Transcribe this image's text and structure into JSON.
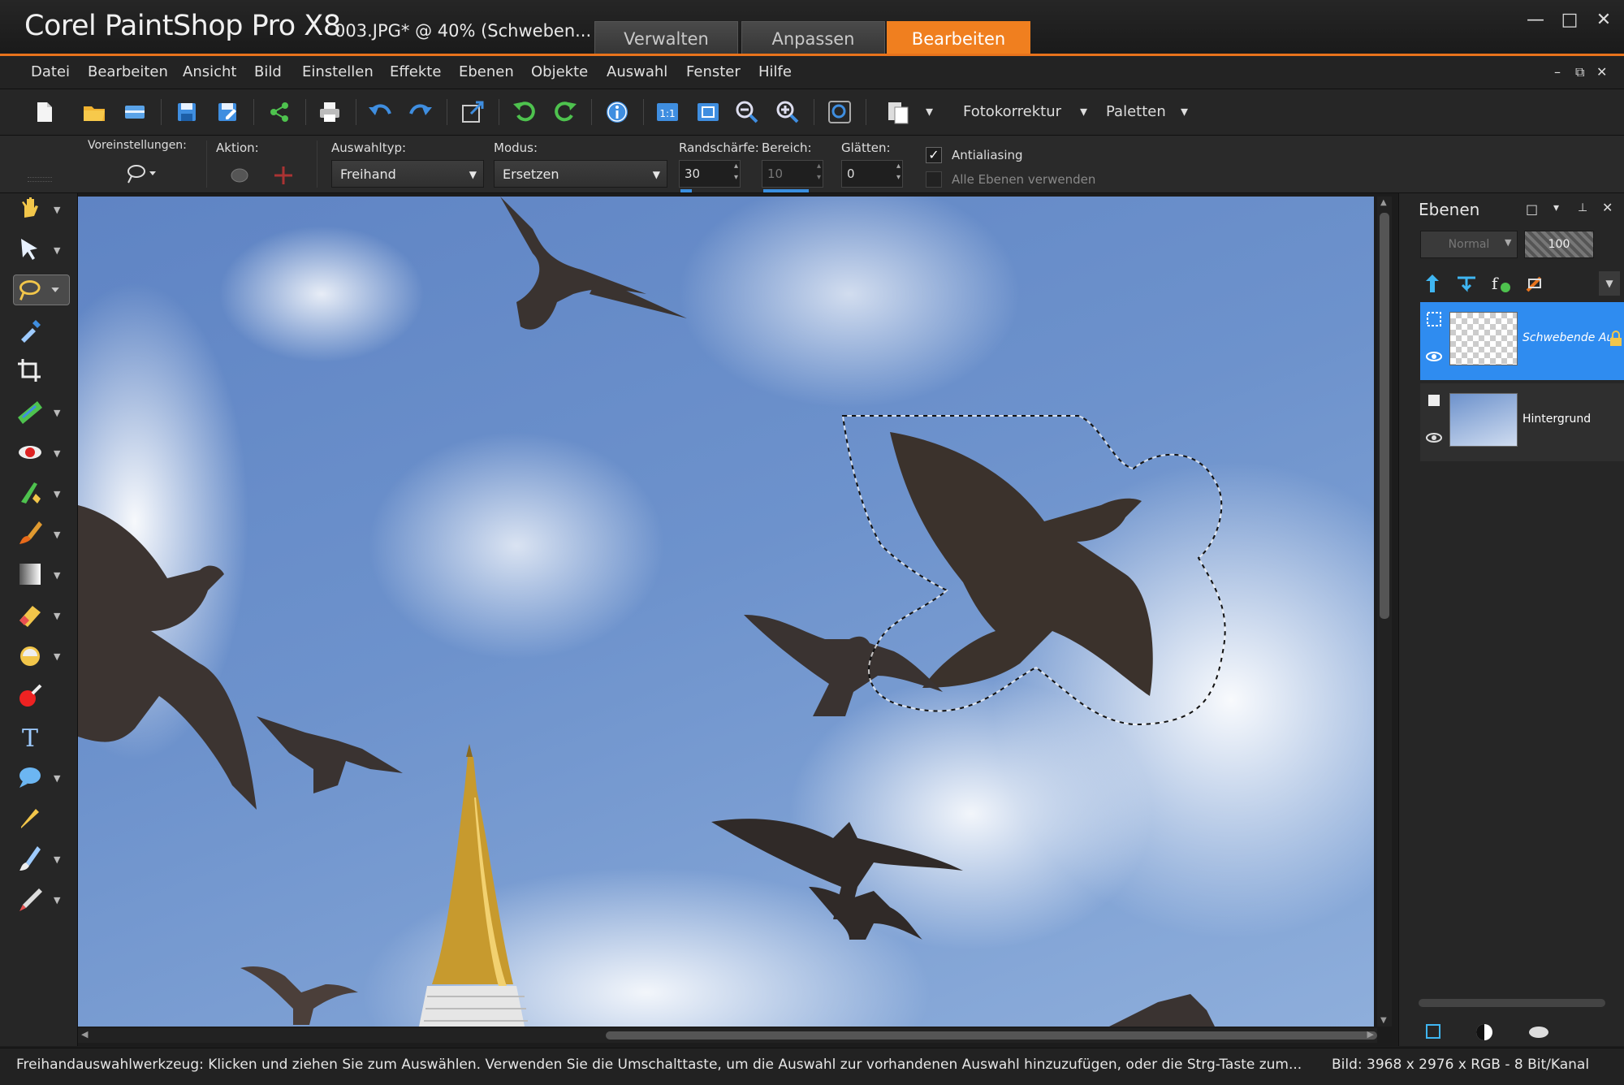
{
  "app": {
    "title": "Corel PaintShop Pro X8",
    "document_title": "003.JPG* @  40% (Schweben..."
  },
  "workspace_tabs": [
    {
      "label": "Verwalten"
    },
    {
      "label": "Anpassen"
    },
    {
      "label": "Bearbeiten",
      "active": true
    }
  ],
  "window_controls": {
    "minimize": "—",
    "maximize": "□",
    "close": "✕"
  },
  "menu": {
    "items": [
      "Datei",
      "Bearbeiten",
      "Ansicht",
      "Bild",
      "Einstellen",
      "Effekte",
      "Ebenen",
      "Objekte",
      "Auswahl",
      "Fenster",
      "Hilfe"
    ],
    "mdi_controls": [
      "–",
      "⧉",
      "✕"
    ]
  },
  "toolbar": {
    "icons": [
      "new-file-icon",
      "open-folder-icon",
      "scan-icon",
      "save-icon",
      "save-as-icon",
      "share-icon",
      "print-icon",
      "undo-icon",
      "redo-icon",
      "resize-icon",
      "rotate-left-icon",
      "rotate-right-icon",
      "info-icon",
      "actual-size-icon",
      "fit-window-icon",
      "zoom-out-icon",
      "zoom-in-icon",
      "zoom-settings-icon",
      "paste-icon"
    ],
    "fotokorrektur_label": "Fotokorrektur",
    "paletten_label": "Paletten"
  },
  "options": {
    "presets_label": "Voreinstellungen:",
    "action_label": "Aktion:",
    "selection_type_label": "Auswahltyp:",
    "selection_type_value": "Freihand",
    "mode_label": "Modus:",
    "mode_value": "Ersetzen",
    "feather_label": "Randschärfe:",
    "feather_value": "30",
    "range_label": "Bereich:",
    "range_value": "10",
    "smoothing_label": "Glätten:",
    "smoothing_value": "0",
    "antialias_label": "Antialiasing",
    "antialias_checked": true,
    "all_layers_label": "Alle Ebenen verwenden",
    "all_layers_checked": false
  },
  "tools": [
    {
      "name": "pan-tool-icon",
      "has_menu": true
    },
    {
      "name": "pick-tool-icon",
      "has_menu": true
    },
    {
      "name": "freehand-selection-tool-icon",
      "has_menu": true,
      "active": true
    },
    {
      "name": "dropper-tool-icon",
      "has_menu": false
    },
    {
      "name": "crop-tool-icon",
      "has_menu": false
    },
    {
      "name": "straighten-tool-icon",
      "has_menu": true
    },
    {
      "name": "red-eye-tool-icon",
      "has_menu": true
    },
    {
      "name": "makeover-tool-icon",
      "has_menu": true
    },
    {
      "name": "paint-brush-tool-icon",
      "has_menu": true
    },
    {
      "name": "fill-tool-icon",
      "has_menu": true
    },
    {
      "name": "eraser-tool-icon",
      "has_menu": true
    },
    {
      "name": "dodge-tool-icon",
      "has_menu": true
    },
    {
      "name": "color-replacer-tool-icon",
      "has_menu": false
    },
    {
      "name": "text-tool-icon",
      "has_menu": false
    },
    {
      "name": "shape-tool-icon",
      "has_menu": true
    },
    {
      "name": "pen-tool-icon",
      "has_menu": false
    },
    {
      "name": "warp-brush-tool-icon",
      "has_menu": true
    },
    {
      "name": "art-media-tool-icon",
      "has_menu": true
    }
  ],
  "layers_panel": {
    "title": "Ebenen",
    "blend_mode": "Normal",
    "opacity": "100",
    "layers": [
      {
        "name": "Schwebende Auswahl",
        "selected": true
      },
      {
        "name": "Hintergrund",
        "selected": false
      }
    ]
  },
  "status": {
    "hint": "Freihandauswahlwerkzeug: Klicken und ziehen Sie zum Auswählen. Verwenden Sie die Umschalttaste, um die Auswahl zur vorhandenen Auswahl hinzuzufügen, oder die Strg-Taste zum...",
    "image_info": "Bild:  3968 x 2976 x RGB - 8 Bit/Kanal"
  },
  "colors": {
    "accent": "#f07f1f",
    "selection_blue": "#2f8cf0",
    "sky": "#6d92cc"
  }
}
